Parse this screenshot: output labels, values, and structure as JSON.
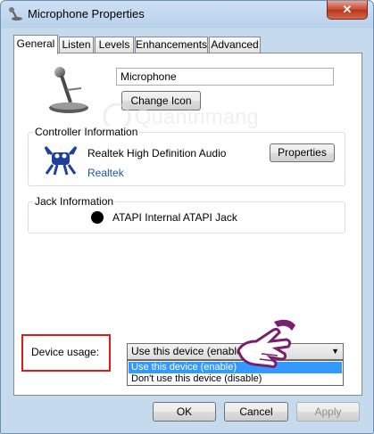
{
  "window": {
    "title": "Microphone Properties",
    "close_symbol": "✕"
  },
  "tabs": [
    {
      "label": "General",
      "active": true
    },
    {
      "label": "Listen",
      "active": false
    },
    {
      "label": "Levels",
      "active": false
    },
    {
      "label": "Enhancements",
      "active": false
    },
    {
      "label": "Advanced",
      "active": false
    }
  ],
  "device": {
    "name_value": "Microphone",
    "change_icon_label": "Change Icon"
  },
  "controller": {
    "group_title": "Controller Information",
    "name": "Realtek High Definition Audio",
    "vendor": "Realtek",
    "properties_label": "Properties"
  },
  "jack": {
    "group_title": "Jack Information",
    "name": "ATAPI Internal ATAPI Jack"
  },
  "watermark": {
    "text": "Quantrimang"
  },
  "usage": {
    "label": "Device usage:",
    "selected": "Use this device (enable)",
    "options": [
      "Use this device (enable)",
      "Don't use this device (disable)"
    ]
  },
  "footer": {
    "ok_label": "OK",
    "cancel_label": "Cancel",
    "apply_label": "Apply"
  },
  "colors": {
    "highlight": "#3399ff",
    "annotation_box": "#e0191b",
    "link": "#1a55a6"
  }
}
